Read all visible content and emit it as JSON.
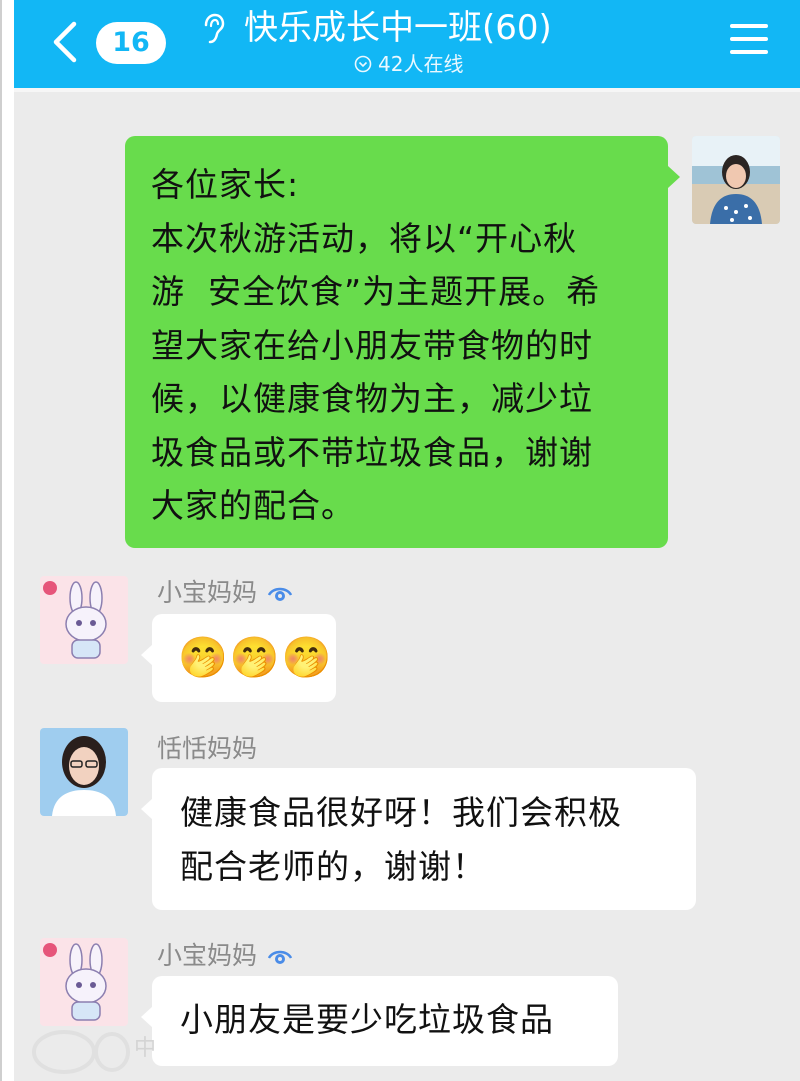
{
  "header": {
    "unread_count": "16",
    "title": "快乐成长中一班(60)",
    "online_text": "42人在线",
    "icons": [
      "back-chevron-icon",
      "ear-icon",
      "online-status-icon",
      "menu-icon"
    ]
  },
  "messages": [
    {
      "id": "teacher-notice",
      "side": "right",
      "sender": "",
      "text_lines": [
        "各位家长:",
        "本次秋游活动，将以“开心秋",
        "游  安全饮食”为主题开展。希",
        "望大家在给小朋友带食物的时",
        "候，以健康食物为主，减少垃",
        "圾食品或不带垃圾食品，谢谢",
        "大家的配合。"
      ]
    },
    {
      "id": "xiaobao-1",
      "side": "left",
      "sender": "小宝妈妈",
      "text": "🤭🤭🤭"
    },
    {
      "id": "tiantian-1",
      "side": "left",
      "sender": "恬恬妈妈",
      "text_lines": [
        "健康食品很好呀！我们会积极",
        "配合老师的，谢谢！"
      ]
    },
    {
      "id": "xiaobao-2",
      "side": "left",
      "sender": "小宝妈妈",
      "text": "小朋友是要少吃垃圾食品"
    }
  ],
  "watermark": "中",
  "colors": {
    "header_bg": "#12b7f5",
    "chat_bg": "#ebebeb",
    "self_bubble": "#68dc4c",
    "other_bubble": "#ffffff"
  }
}
